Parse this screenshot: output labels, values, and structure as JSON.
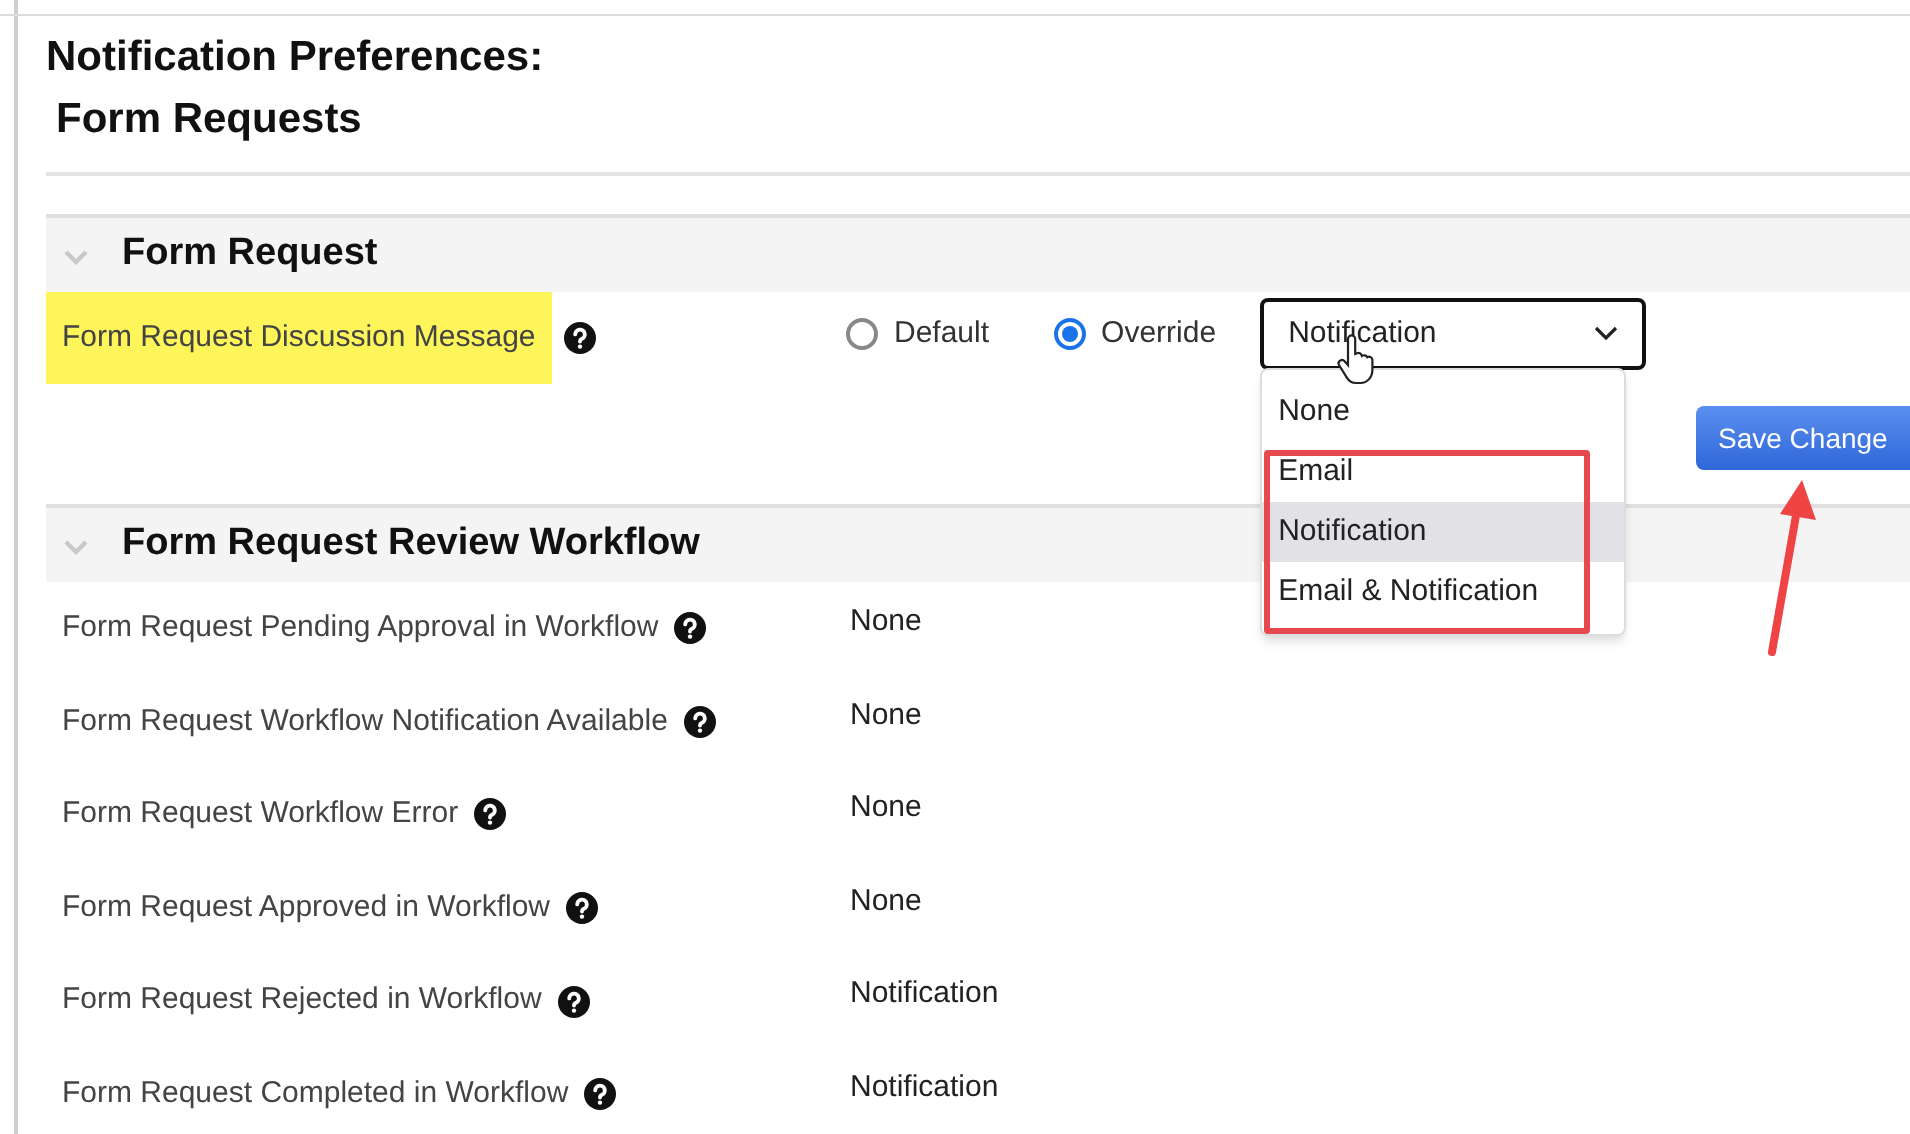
{
  "title": {
    "line_1": "Notification Preferences:",
    "line_2": "Form Requests"
  },
  "sections": [
    {
      "heading": "Form Request",
      "expanded": true,
      "rows": [
        {
          "kind": "editable",
          "label": "Form Request Discussion Message",
          "highlighted": true,
          "radios": [
            {
              "label": "Default",
              "selected": false
            },
            {
              "label": "Override",
              "selected": true
            }
          ],
          "select": {
            "value": "Notification",
            "open": true,
            "options": [
              {
                "label": "None",
                "selected": false
              },
              {
                "label": "Email",
                "selected": false
              },
              {
                "label": "Notification",
                "selected": true
              },
              {
                "label": "Email & Notification",
                "selected": false
              }
            ]
          }
        }
      ]
    },
    {
      "heading": "Form Request Review Workflow",
      "expanded": true,
      "rows": [
        {
          "kind": "readonly",
          "label": "Form Request Pending Approval in Workflow",
          "highlighted": false,
          "value": "None"
        },
        {
          "kind": "readonly",
          "label": "Form Request Workflow Notification Available",
          "highlighted": false,
          "value": "None"
        },
        {
          "kind": "readonly",
          "label": "Form Request Workflow Error",
          "highlighted": false,
          "value": "None"
        },
        {
          "kind": "readonly",
          "label": "Form Request Approved in Workflow",
          "highlighted": false,
          "value": "None"
        },
        {
          "kind": "readonly",
          "label": "Form Request Rejected in Workflow",
          "highlighted": false,
          "value": "Notification"
        },
        {
          "kind": "readonly",
          "label": "Form Request Completed in Workflow",
          "highlighted": false,
          "value": "Notification"
        }
      ]
    }
  ],
  "save_button": "Save Change"
}
